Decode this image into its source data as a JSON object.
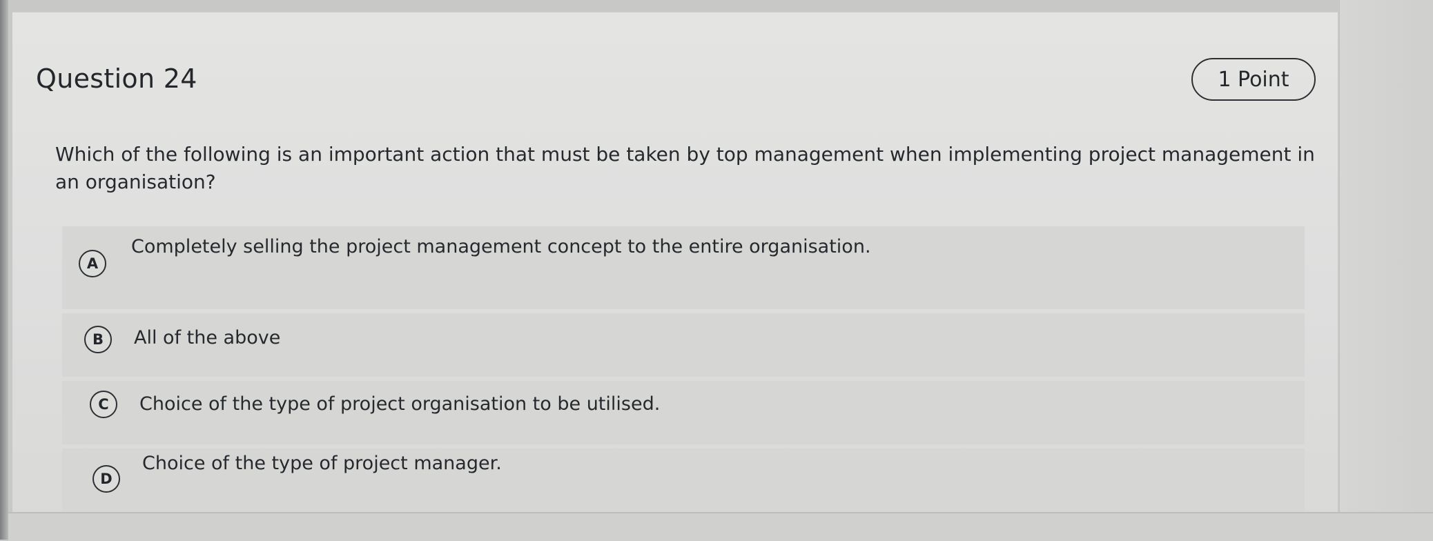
{
  "question": {
    "title": "Question 24",
    "points": "1 Point",
    "prompt": "Which of the following is an important action that must be taken by top management when implementing project management in an organisation?"
  },
  "options": [
    {
      "letter": "A",
      "text": "Completely selling the project management concept to the entire organisation."
    },
    {
      "letter": "B",
      "text": "All of the above"
    },
    {
      "letter": "C",
      "text": "Choice of the type of project organisation to be utilised."
    },
    {
      "letter": "D",
      "text": "Choice of the type of project manager."
    }
  ]
}
